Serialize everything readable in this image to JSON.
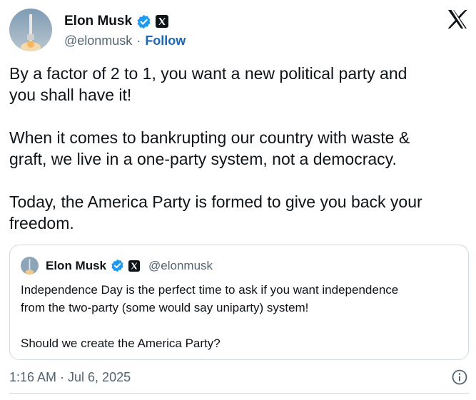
{
  "author": {
    "name": "Elon Musk",
    "handle": "@elonmusk",
    "separator": "·",
    "follow_label": "Follow"
  },
  "post": {
    "text": "By a factor of 2 to 1, you want a new political party and\nyou shall have it!\n\nWhen it comes to bankrupting our country with waste &\ngraft, we live in a one-party system, not a democracy.\n\nToday, the America Party is formed to give you back your\nfreedom."
  },
  "quoted_post": {
    "name": "Elon Musk",
    "handle": "@elonmusk",
    "text": "Independence Day is the perfect time to ask if you want independence\nfrom the two-party (some would say uniparty) system!\n\nShould we create the America Party?"
  },
  "timestamp": "1:16 AM · Jul 6, 2025",
  "icons": {
    "verified": "verified-badge-icon",
    "affiliation": "x-affiliation-icon",
    "brand": "x-logo-icon",
    "info": "info-icon"
  },
  "colors": {
    "verified_blue": "#1d9bf0",
    "follow_blue": "#1d67b5",
    "secondary_text": "#536471"
  }
}
